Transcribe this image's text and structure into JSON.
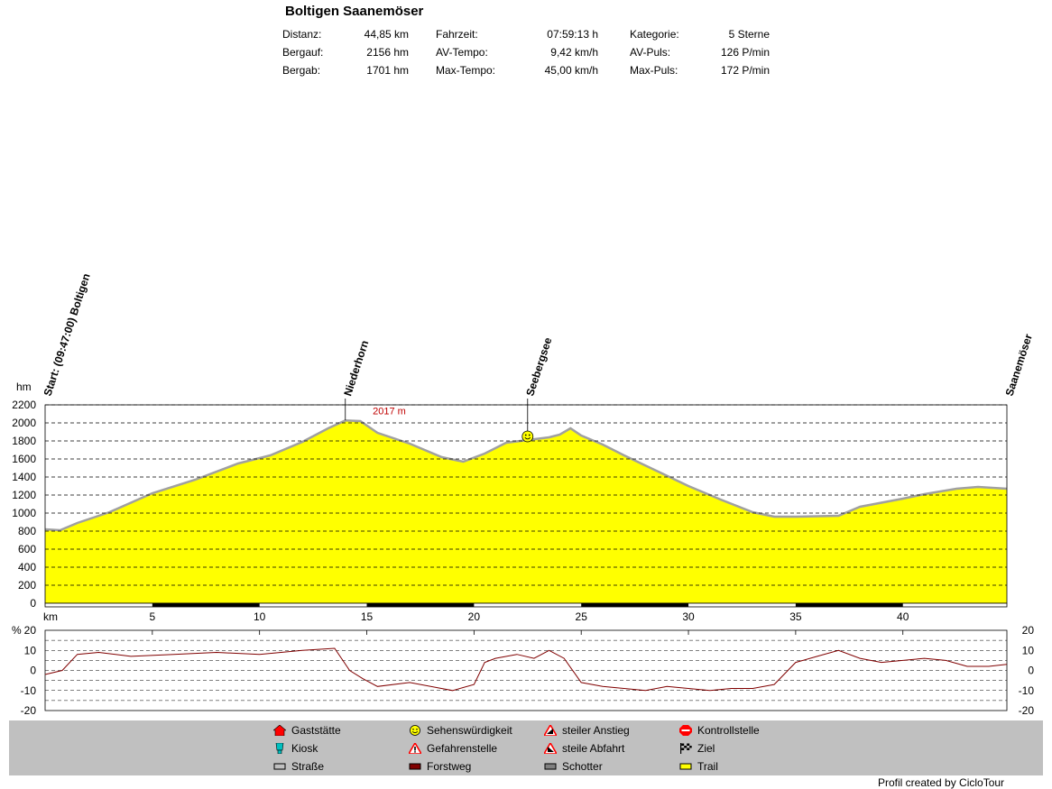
{
  "header": {
    "title": "Boltigen Saanemöser",
    "stats": [
      {
        "label": "Distanz:",
        "value": "44,85 km"
      },
      {
        "label": "Bergauf:",
        "value": "2156 hm"
      },
      {
        "label": "Bergab:",
        "value": "1701 hm"
      },
      {
        "label": "Fahrzeit:",
        "value": "07:59:13 h"
      },
      {
        "label": "AV-Tempo:",
        "value": "9,42 km/h"
      },
      {
        "label": "Max-Tempo:",
        "value": "45,00 km/h"
      },
      {
        "label": "Kategorie:",
        "value": "5 Sterne"
      },
      {
        "label": "AV-Puls:",
        "value": "126 P/min"
      },
      {
        "label": "Max-Puls:",
        "value": "172 P/min"
      }
    ]
  },
  "chart_data": [
    {
      "type": "area",
      "ylabel": "hm",
      "xlabel": "km",
      "ylim": [
        0,
        2200
      ],
      "xlim": [
        0,
        44.85
      ],
      "yticks": [
        0,
        200,
        400,
        600,
        800,
        1000,
        1200,
        1400,
        1600,
        1800,
        2000,
        2200
      ],
      "xticks": [
        5,
        10,
        15,
        20,
        25,
        30,
        35,
        40
      ],
      "grid": "dashed-horizontal",
      "fill_color": "#ffff00",
      "x": [
        0,
        0.7,
        1.5,
        3,
        5,
        7,
        9,
        10.5,
        12,
        13.2,
        14,
        14.7,
        15.5,
        17,
        18.5,
        19.5,
        20.5,
        21.5,
        22.5,
        23.5,
        24,
        24.5,
        25,
        26,
        27,
        28.5,
        30,
        31.5,
        33,
        34,
        35,
        37,
        38,
        40,
        41,
        42.5,
        43.5,
        44.85
      ],
      "elevation": [
        810,
        800,
        880,
        1000,
        1210,
        1360,
        1540,
        1630,
        1780,
        1930,
        2017,
        2010,
        1880,
        1760,
        1610,
        1560,
        1650,
        1770,
        1800,
        1830,
        1860,
        1930,
        1850,
        1750,
        1630,
        1460,
        1290,
        1140,
        1000,
        950,
        950,
        960,
        1060,
        1150,
        1200,
        1260,
        1280,
        1260
      ],
      "annotations": [
        {
          "label": "Start: (09:47:00) Boltigen",
          "km": 0
        },
        {
          "label": "Niederhorn",
          "km": 14
        },
        {
          "label": "Seebergsee",
          "km": 22.5
        },
        {
          "label": "Saanemöser",
          "km": 44.85
        }
      ],
      "peak_label": "2017 m",
      "peak": {
        "km": 14.1,
        "hm": 2017
      }
    },
    {
      "type": "line",
      "ylabel": "%",
      "ylim": [
        -20,
        20
      ],
      "yticks": [
        20,
        10,
        0,
        -10,
        -20
      ],
      "series": [
        {
          "color": "#800000",
          "x": [
            0,
            0.8,
            1.5,
            2.5,
            4,
            6,
            8,
            10,
            12,
            13.5,
            14.2,
            14.8,
            15.5,
            17,
            19,
            20,
            20.5,
            21,
            22,
            22.8,
            23.5,
            24.2,
            25,
            26,
            27,
            28,
            29,
            30,
            31,
            32,
            33,
            34,
            35,
            36,
            37,
            38,
            39,
            40,
            41,
            42,
            43,
            44,
            44.85
          ],
          "values": [
            -2,
            0,
            8,
            9,
            7,
            8,
            9,
            8,
            10,
            11,
            0,
            -4,
            -8,
            -6,
            -10,
            -7,
            4,
            6,
            8,
            6,
            10,
            6,
            -6,
            -8,
            -9,
            -10,
            -8,
            -9,
            -10,
            -9,
            -9,
            -7,
            4,
            7,
            10,
            6,
            4,
            5,
            6,
            5,
            2,
            2,
            3
          ]
        }
      ]
    }
  ],
  "legend": [
    {
      "label": "Gaststätte",
      "icon": "house-icon",
      "color": "#ff0000"
    },
    {
      "label": "Sehenswürdigkeit",
      "icon": "smiley-icon",
      "color": "#ffff00"
    },
    {
      "label": "steiler Anstieg",
      "icon": "steep-climb-icon",
      "color": "#ff0000"
    },
    {
      "label": "Kontrollstelle",
      "icon": "stop-icon",
      "color": "#ff0000"
    },
    {
      "label": "Kiosk",
      "icon": "kiosk-icon",
      "color": "#00c0c0"
    },
    {
      "label": "Gefahrenstelle",
      "icon": "warning-icon",
      "color": "#ff0000"
    },
    {
      "label": "steile Abfahrt",
      "icon": "steep-descent-icon",
      "color": "#ff0000"
    },
    {
      "label": "Ziel",
      "icon": "finish-flag-icon",
      "color": "#000000"
    },
    {
      "label": "Straße",
      "icon": "road-icon",
      "color": "#c0c0c0"
    },
    {
      "label": "Forstweg",
      "icon": "forest-road-icon",
      "color": "#800000"
    },
    {
      "label": "Schotter",
      "icon": "gravel-icon",
      "color": "#808080"
    },
    {
      "label": "Trail",
      "icon": "trail-icon",
      "color": "#ffff00"
    }
  ],
  "footer": "Profil created by CicloTour"
}
